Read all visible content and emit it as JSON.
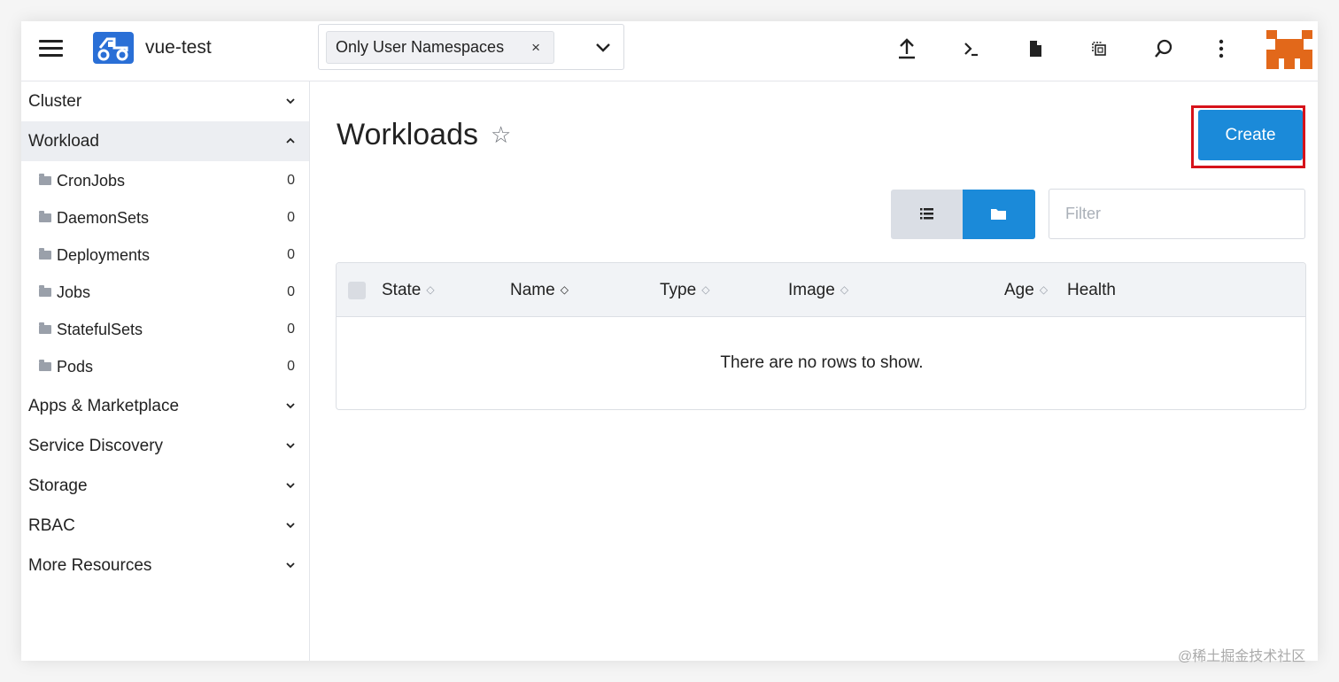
{
  "header": {
    "cluster_name": "vue-test",
    "namespace_chip": "Only User Namespaces",
    "namespace_chip_close": "×",
    "icons": [
      "menu-icon",
      "upload-icon",
      "terminal-icon",
      "file-icon",
      "copy-icon",
      "search-icon",
      "more-vertical-icon"
    ]
  },
  "sidebar": {
    "groups_top": [
      {
        "label": "Cluster",
        "chevron": "down"
      },
      {
        "label": "Workload",
        "chevron": "up"
      }
    ],
    "workload_items": [
      {
        "label": "CronJobs",
        "count": "0"
      },
      {
        "label": "DaemonSets",
        "count": "0"
      },
      {
        "label": "Deployments",
        "count": "0"
      },
      {
        "label": "Jobs",
        "count": "0"
      },
      {
        "label": "StatefulSets",
        "count": "0"
      },
      {
        "label": "Pods",
        "count": "0"
      }
    ],
    "groups_bottom": [
      {
        "label": "Apps & Marketplace"
      },
      {
        "label": "Service Discovery"
      },
      {
        "label": "Storage"
      },
      {
        "label": "RBAC"
      },
      {
        "label": "More Resources"
      }
    ]
  },
  "main": {
    "title": "Workloads",
    "star_icon": "☆",
    "create_label": "Create",
    "filter_placeholder": "Filter",
    "columns": [
      "State",
      "Name",
      "Type",
      "Image",
      "Age",
      "Health"
    ],
    "empty_message": "There are no rows to show."
  },
  "watermark": "@稀土掘金技术社区",
  "colors": {
    "accent": "#1b8ad9",
    "highlight_border": "#d6121a",
    "avatar": "#e2681a"
  }
}
